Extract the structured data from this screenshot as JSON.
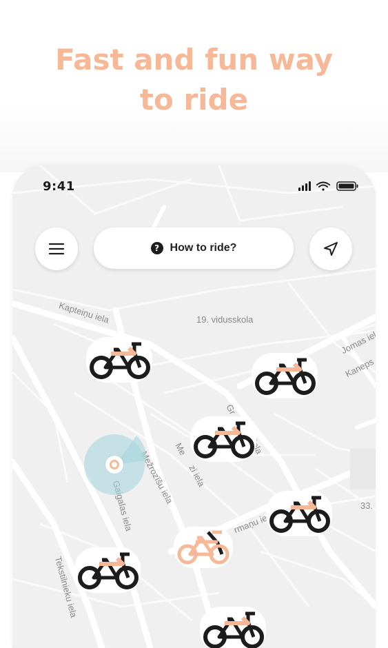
{
  "headline": {
    "line1": "Fast and fun way",
    "line2": "to ride"
  },
  "status_bar": {
    "time": "9:41"
  },
  "toolbar": {
    "how_to_ride_label": "How to ride?",
    "help_icon_glyph": "?"
  },
  "map_labels": {
    "street_kapteinu": "Kapteiņu iela",
    "school": "19. vidusskola",
    "street_jomas": "Jomas iela",
    "street_kanepes": "Kaneps",
    "street_gr": "Gr",
    "street_iela": "iela",
    "street_mezrozisu": "Mežrozīšu iela",
    "street_me": "Me",
    "street_zi": "zi iela",
    "street_gaigalas": "Gaigalas iela",
    "street_rmanu": "rmaņu iela",
    "number_33": "33.",
    "street_tekstilnieku": "Tekstilnieku iela"
  },
  "colors": {
    "accent": "#f6b897",
    "bike_dark": "#1c1c1c",
    "map_bg": "#f0f0f0",
    "road": "#ffffff",
    "location_halo": "#a4d6de"
  },
  "icons": {
    "menu": "hamburger-menu-icon",
    "locate": "navigation-arrow-icon",
    "bike": "bicycle-icon"
  }
}
